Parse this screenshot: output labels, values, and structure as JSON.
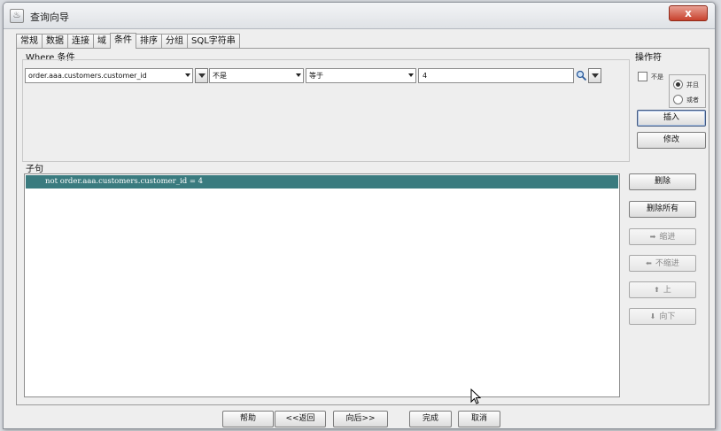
{
  "window": {
    "title": "查询向导",
    "close_label": "x"
  },
  "tabs": [
    {
      "label": "常规",
      "active": false
    },
    {
      "label": "数据",
      "active": false
    },
    {
      "label": "连接",
      "active": false
    },
    {
      "label": "域",
      "active": false
    },
    {
      "label": "条件",
      "active": true
    },
    {
      "label": "排序",
      "active": false
    },
    {
      "label": "分组",
      "active": false
    },
    {
      "label": "SQL字符串",
      "active": false
    }
  ],
  "where": {
    "label": "Where 条件",
    "column_value": "order.aaa.customers.customer_id",
    "not_value": "不是",
    "operator_value": "等于",
    "input_value": "4"
  },
  "operators": {
    "label": "操作符",
    "not_label": "不是",
    "and_label": "并且",
    "or_label": "或者",
    "and_checked": true,
    "insert_label": "插入",
    "modify_label": "修改"
  },
  "clause": {
    "label": "子句",
    "rows": [
      "not order.aaa.customers.customer_id = 4"
    ]
  },
  "side_buttons": {
    "delete_label": "删除",
    "delete_all_label": "删除所有",
    "indent_label": "缩进",
    "unindent_label": "不缩进",
    "up_label": "上",
    "down_label": "向下"
  },
  "bottom_buttons": {
    "help_label": "帮助",
    "back_label": "<<返回",
    "next_label": "向后>>",
    "finish_label": "完成",
    "cancel_label": "取消"
  }
}
